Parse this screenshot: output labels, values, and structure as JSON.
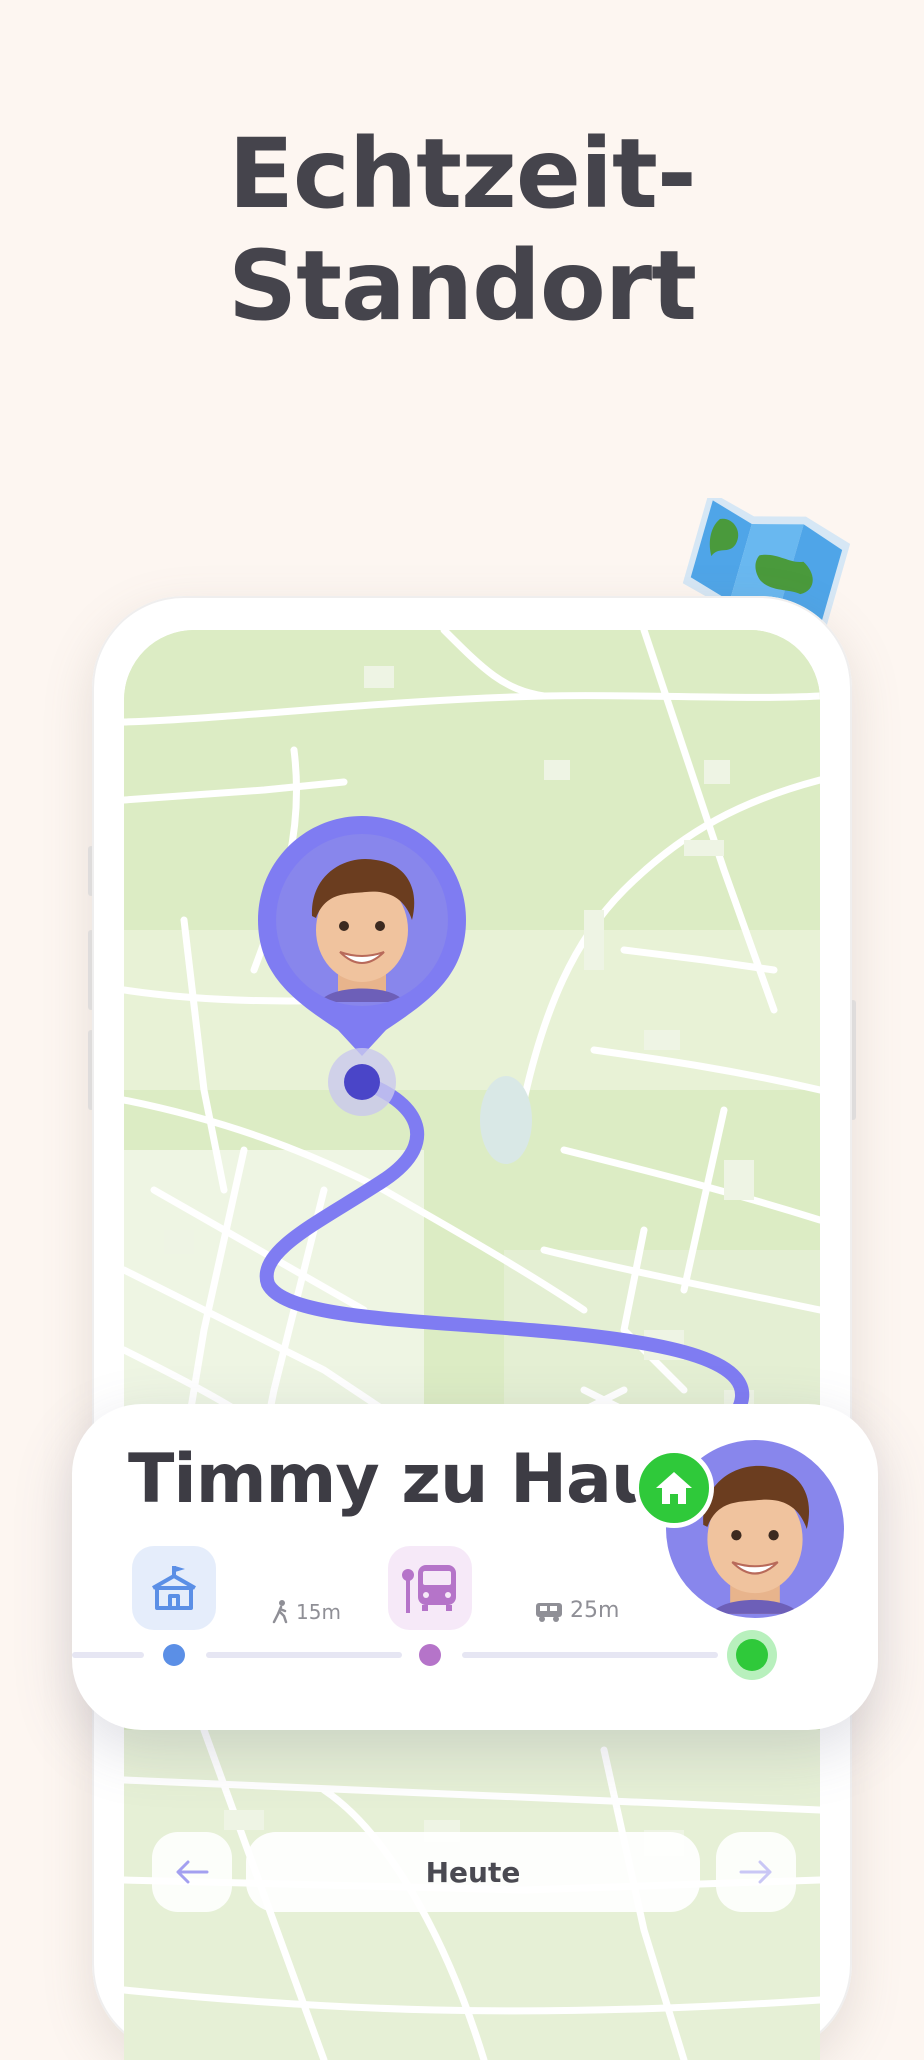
{
  "headline": "Echtzeit-Standort",
  "card": {
    "title": "Timmy zu Hause",
    "status_icon": "home-icon",
    "avatar_icon": "child-avatar",
    "stops": [
      {
        "icon": "school-icon",
        "color": "#5b8fe6"
      },
      {
        "icon": "bus-stop-icon",
        "color": "#b574c9"
      },
      {
        "icon": "home-dot",
        "color": "#2fc93a"
      }
    ],
    "segments": [
      {
        "icon": "walk-icon",
        "label": "15m"
      },
      {
        "icon": "car-icon",
        "label": "25m"
      }
    ]
  },
  "nav": {
    "prev_icon": "arrow-left-icon",
    "next_icon": "arrow-right-icon",
    "date_label": "Heute"
  },
  "colors": {
    "accent": "#7f7cf2",
    "map_green": "#dcecc4",
    "home_green": "#2fc93a",
    "background": "#fdf6f1"
  }
}
